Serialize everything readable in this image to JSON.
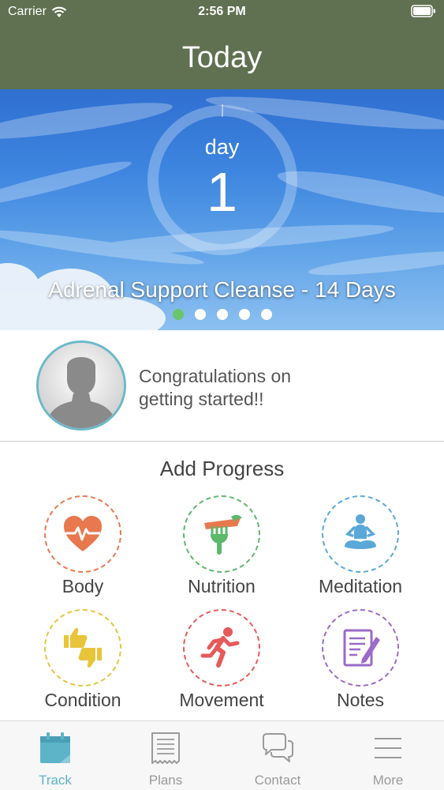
{
  "status_bar": {
    "carrier": "Carrier",
    "time": "2:56 PM"
  },
  "nav": {
    "title": "Today"
  },
  "hero": {
    "day_label": "day",
    "day_number": "1",
    "program_name": "Adrenal Support Cleanse - 14 Days",
    "page_count": 5,
    "active_page": 1
  },
  "message": {
    "text_line1": "Congratulations on",
    "text_line2": "getting started!!"
  },
  "progress": {
    "title": "Add Progress",
    "items": [
      {
        "label": "Body",
        "icon": "heart-pulse-icon",
        "color": "#e8784e"
      },
      {
        "label": "Nutrition",
        "icon": "fork-carrot-icon",
        "color": "#5cb86a"
      },
      {
        "label": "Meditation",
        "icon": "meditation-icon",
        "color": "#5aa8d8"
      },
      {
        "label": "Condition",
        "icon": "thumbs-icon",
        "color": "#e8c43a"
      },
      {
        "label": "Movement",
        "icon": "running-icon",
        "color": "#e65a5a"
      },
      {
        "label": "Notes",
        "icon": "notes-icon",
        "color": "#9b6ac8"
      }
    ]
  },
  "tabs": [
    {
      "label": "Track",
      "icon": "calendar-icon",
      "active": true
    },
    {
      "label": "Plans",
      "icon": "document-icon",
      "active": false
    },
    {
      "label": "Contact",
      "icon": "chat-bubbles-icon",
      "active": false
    },
    {
      "label": "More",
      "icon": "menu-icon",
      "active": false
    }
  ],
  "colors": {
    "nav_bg": "#5f7150",
    "accent": "#5db4c9",
    "active_dot": "#6cc46b"
  }
}
